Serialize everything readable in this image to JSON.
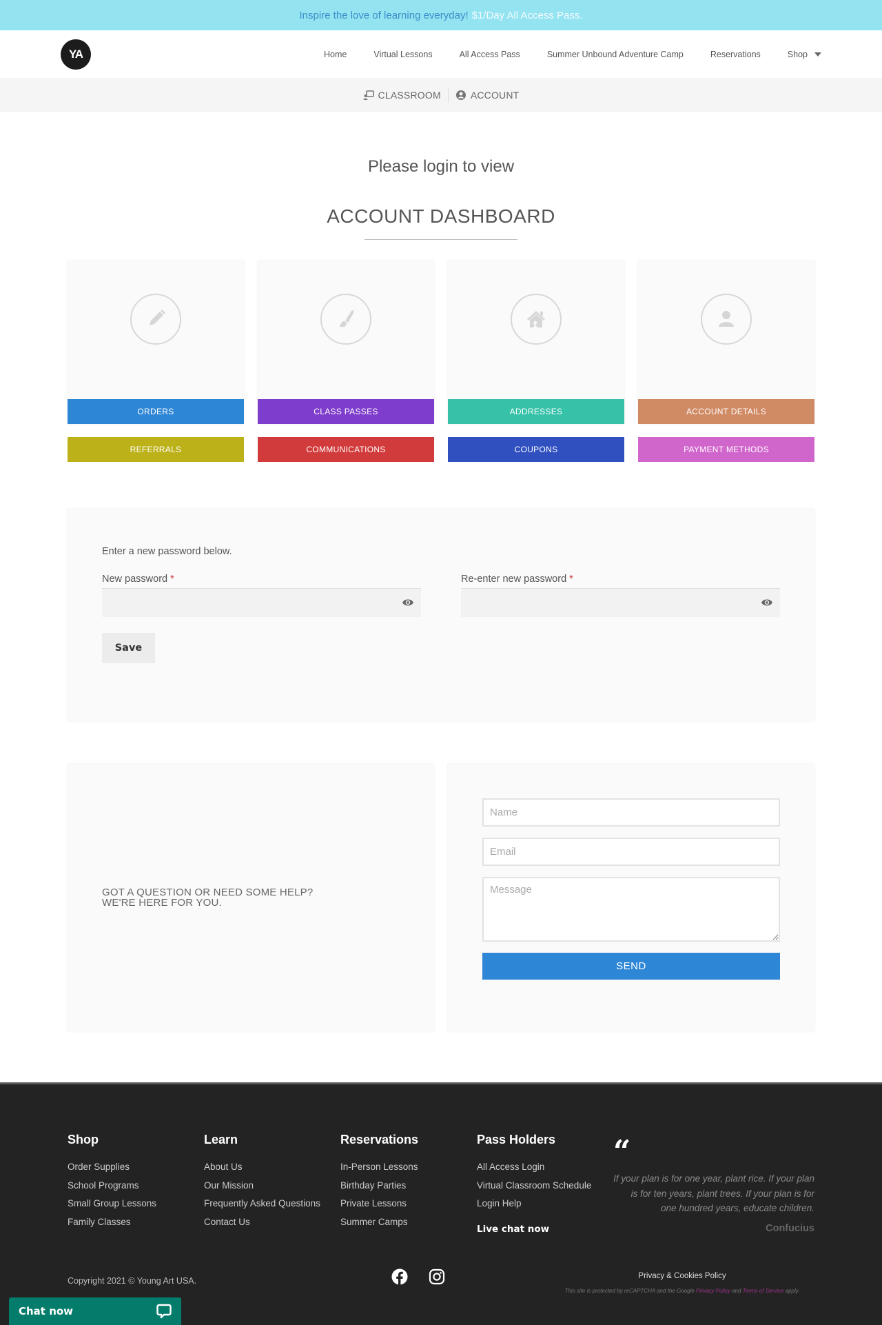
{
  "banner": {
    "lead": "Inspire the love of learning everyday!",
    "promo": "$1/Day All Access Pass.",
    "colors": {
      "background": "#93e3f1",
      "lead": "#3a8fc9",
      "promo": "#f4fbfd"
    }
  },
  "header": {
    "logo_text": "YA",
    "nav": [
      {
        "label": "Home"
      },
      {
        "label": "Virtual Lessons"
      },
      {
        "label": "All Access Pass"
      },
      {
        "label": "Summer Unbound Adventure Camp"
      },
      {
        "label": "Reservations"
      },
      {
        "label": "Shop",
        "has_dropdown": true
      }
    ]
  },
  "subnav": {
    "items": [
      {
        "label": "CLASSROOM",
        "icon": "classroom-icon"
      },
      {
        "label": "ACCOUNT",
        "icon": "user-circle-icon"
      }
    ]
  },
  "main": {
    "notice": "Please login to view",
    "title": "ACCOUNT DASHBOARD",
    "tiles": [
      {
        "label": "ORDERS",
        "icon": "pencil-icon",
        "color": "#2e86d6"
      },
      {
        "label": "CLASS PASSES",
        "icon": "paintbrush-icon",
        "color": "#7e3dcc"
      },
      {
        "label": "ADDRESSES",
        "icon": "home-icon",
        "color": "#36c1a9"
      },
      {
        "label": "ACCOUNT DETAILS",
        "icon": "user-icon",
        "color": "#d08a64"
      }
    ],
    "buttons_row2": [
      {
        "label": "REFERRALS",
        "color": "#bcb119"
      },
      {
        "label": "COMMUNICATIONS",
        "color": "#d13b3b"
      },
      {
        "label": "COUPONS",
        "color": "#3050c0"
      },
      {
        "label": "PAYMENT METHODS",
        "color": "#d065cc"
      }
    ]
  },
  "password_form": {
    "intro": "Enter a new password below.",
    "new_password_label": "New password",
    "reenter_label": "Re-enter new password",
    "required_mark": "*",
    "new_password_value": "",
    "reenter_value": "",
    "save_label": "Save"
  },
  "contact": {
    "help_line1": "GOT A QUESTION OR NEED SOME HELP?",
    "help_line2": "WE'RE HERE FOR YOU.",
    "name_placeholder": "Name",
    "email_placeholder": "Email",
    "message_placeholder": "Message",
    "send_label": "SEND"
  },
  "footer": {
    "columns": [
      {
        "heading": "Shop",
        "links": [
          "Order Supplies",
          "School Programs",
          "Small Group Lessons",
          "Family Classes"
        ]
      },
      {
        "heading": "Learn",
        "links": [
          "About Us",
          "Our Mission",
          "Frequently Asked Questions",
          "Contact Us"
        ]
      },
      {
        "heading": "Reservations",
        "links": [
          "In-Person Lessons",
          "Birthday Parties",
          "Private Lessons",
          "Summer Camps"
        ]
      },
      {
        "heading": "Pass Holders",
        "links": [
          "All Access Login",
          "Virtual Classroom Schedule",
          "Login Help"
        ],
        "extra": "Live chat now"
      }
    ],
    "quote_mark": "“",
    "quote": "If your plan is for one year, plant rice. If your plan is for ten years, plant trees. If your plan is for one hundred years, educate children.",
    "author": "Confucius",
    "copyright": "Copyright 2021 © Young Art USA.",
    "social": [
      "facebook-icon",
      "instagram-icon"
    ],
    "privacy": "Privacy & Cookies Policy",
    "recaptcha_prefix": "This site is protected by reCAPTCHA and the Google",
    "recaptcha_privacy": "Privacy Policy",
    "recaptcha_and": "and",
    "recaptcha_terms": "Terms of Service",
    "recaptcha_suffix": "apply."
  },
  "chat_widget": {
    "label": "Chat now",
    "color": "#047c6b"
  }
}
